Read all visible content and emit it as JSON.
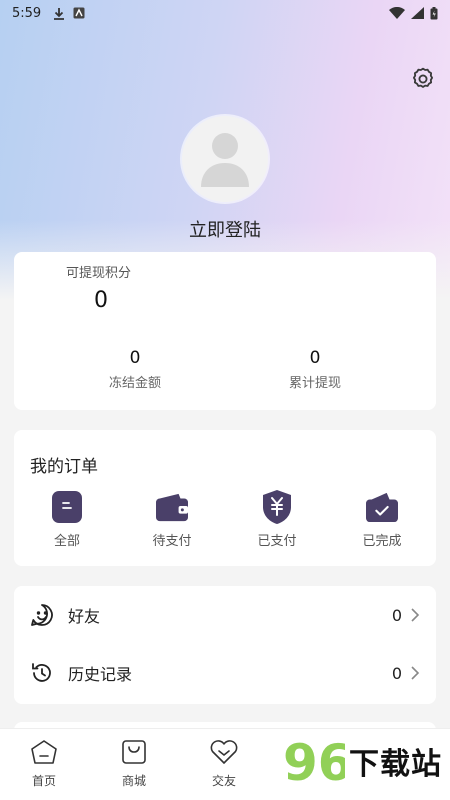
{
  "status_bar": {
    "time": "5:59"
  },
  "profile": {
    "login_text": "立即登陆"
  },
  "points": {
    "label": "可提现积分",
    "value": "0",
    "stats": [
      {
        "value": "0",
        "label": "冻结金额"
      },
      {
        "value": "0",
        "label": "累计提现"
      }
    ]
  },
  "orders": {
    "title": "我的订单",
    "items": [
      {
        "label": "全部",
        "icon": "all-orders-icon"
      },
      {
        "label": "待支付",
        "icon": "wallet-icon"
      },
      {
        "label": "已支付",
        "icon": "yuan-shield-icon"
      },
      {
        "label": "已完成",
        "icon": "completed-check-icon"
      }
    ]
  },
  "menu": [
    {
      "label": "好友",
      "count": "0",
      "icon": "smile-icon"
    },
    {
      "label": "历史记录",
      "count": "0",
      "icon": "history-icon"
    }
  ],
  "tabs": [
    {
      "label": "首页",
      "icon": "home-icon"
    },
    {
      "label": "商城",
      "icon": "bag-icon"
    },
    {
      "label": "交友",
      "icon": "heart-icon"
    }
  ],
  "watermark": {
    "text": "下载站"
  },
  "colors": {
    "accent": "#4a4069",
    "background": "#f4f4f4"
  }
}
